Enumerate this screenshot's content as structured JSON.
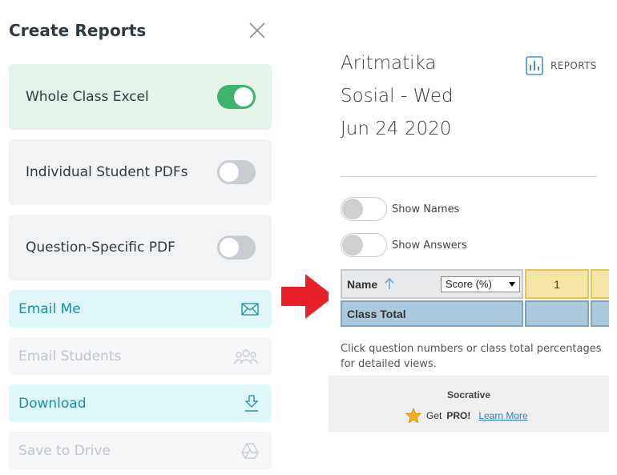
{
  "left_panel": {
    "title": "Create Reports",
    "options": [
      {
        "label": "Whole Class Excel",
        "enabled": true
      },
      {
        "label": "Individual Student PDFs",
        "enabled": false
      },
      {
        "label": "Question-Specific PDF",
        "enabled": false
      }
    ],
    "actions": [
      {
        "label": "Email Me",
        "icon": "envelope-icon",
        "state": "active"
      },
      {
        "label": "Email Students",
        "icon": "people-icon",
        "state": "disabled"
      },
      {
        "label": "Download",
        "icon": "download-icon",
        "state": "active"
      },
      {
        "label": "Save to Drive",
        "icon": "drive-icon",
        "state": "disabled"
      }
    ]
  },
  "annotation": {
    "icon": "red-arrow-icon",
    "color": "#e8202a"
  },
  "right_panel": {
    "title_lines": [
      "Aritmatika",
      "Sosial - Wed",
      "Jun 24 2020"
    ],
    "reports_button": "REPORTS",
    "switches": [
      {
        "label": "Show Names",
        "enabled": false
      },
      {
        "label": "Show Answers",
        "enabled": false
      }
    ],
    "table": {
      "name_header": "Name",
      "sort_select": "Score (%)",
      "question_numbers": [
        "1"
      ],
      "total_row_label": "Class Total"
    },
    "hint": "Click question numbers or class total percentages for detailed views.",
    "footer": {
      "brand": "Socrative",
      "promo_prefix": "Get ",
      "promo_bold": "PRO!",
      "promo_link": "Learn More"
    }
  },
  "colors": {
    "toggle_on": "#3cb46e",
    "accent_teal": "#1a8fa6",
    "question_header": "#f5e6a8",
    "total_row": "#acc8dc"
  }
}
